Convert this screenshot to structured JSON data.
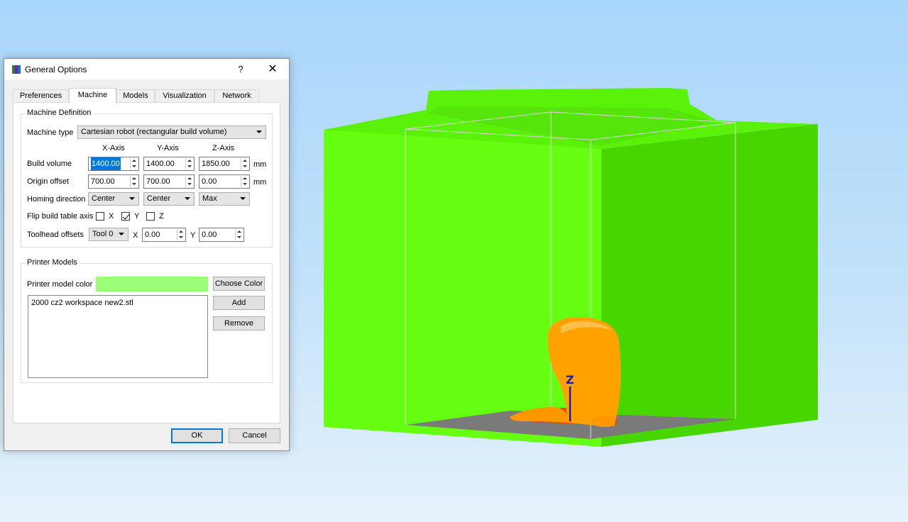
{
  "window": {
    "title": "General Options",
    "help_label": "?",
    "close_label": "✕"
  },
  "tabs": [
    {
      "label": "Preferences",
      "active": false
    },
    {
      "label": "Machine",
      "active": true
    },
    {
      "label": "Models",
      "active": false
    },
    {
      "label": "Visualization",
      "active": false
    },
    {
      "label": "Network",
      "active": false
    }
  ],
  "machine_definition": {
    "title": "Machine Definition",
    "machine_type_label": "Machine type",
    "machine_type_value": "Cartesian robot (rectangular build volume)",
    "axis_headers": [
      "X-Axis",
      "Y-Axis",
      "Z-Axis"
    ],
    "build_volume": {
      "label": "Build volume",
      "values": [
        "1400.00",
        "1400.00",
        "1850.00"
      ],
      "unit": "mm"
    },
    "origin_offset": {
      "label": "Origin offset",
      "values": [
        "700.00",
        "700.00",
        "0.00"
      ],
      "unit": "mm"
    },
    "homing_direction": {
      "label": "Homing direction",
      "values": [
        "Center",
        "Center",
        "Max"
      ]
    },
    "flip_build_table_axis": {
      "label": "Flip build table axis",
      "options": [
        {
          "label": "X",
          "checked": false
        },
        {
          "label": "Y",
          "checked": true
        },
        {
          "label": "Z",
          "checked": false
        }
      ]
    },
    "toolhead_offsets": {
      "label": "Toolhead offsets",
      "tool_value": "Tool 0",
      "x_label": "X",
      "x_value": "0.00",
      "y_label": "Y",
      "y_value": "0.00"
    }
  },
  "printer_models": {
    "title": "Printer Models",
    "color_label": "Printer model color",
    "color_value": "#9dff77",
    "choose_color_label": "Choose Color",
    "add_label": "Add",
    "remove_label": "Remove",
    "models": [
      "2000 cz2 workspace new2.stl"
    ]
  },
  "footer": {
    "ok_label": "OK",
    "cancel_label": "Cancel"
  },
  "scene": {
    "axis_label": "Z",
    "printer_color": "#5cf000",
    "model_color": "#ffa200",
    "background_color": "#a9d6fb"
  }
}
